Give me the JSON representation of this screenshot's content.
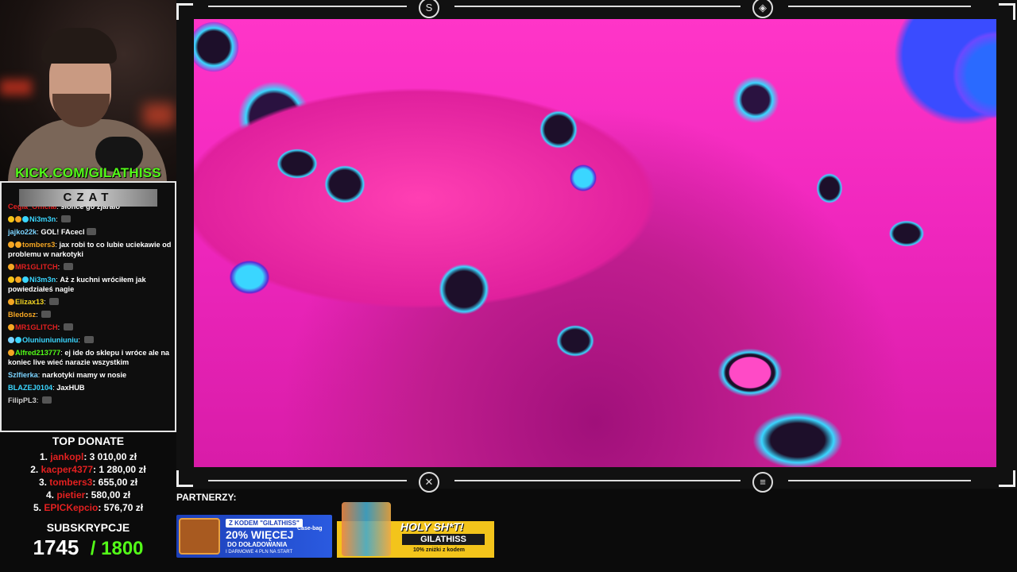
{
  "webcam": {
    "overlay_url": "KICK.COM/GILATHISS"
  },
  "chat": {
    "title": "CZAT",
    "messages": [
      {
        "user": "Cegla_Official",
        "user_color": "#e32020",
        "text": "słońce go zjarało",
        "badges": []
      },
      {
        "user": "Ni3m3n",
        "user_color": "#3ad6ff",
        "text": "",
        "badges": [
          "crown",
          "clock",
          "gem"
        ],
        "emote": true
      },
      {
        "user": "jajko22k",
        "user_color": "#7bd3ff",
        "text": "GOL! FAcecl",
        "badges": [],
        "emote": true
      },
      {
        "user": "tombers3",
        "user_color": "#f5a623",
        "text": "jax robi to co lubie uciekawie od problemu w narkotyki",
        "badges": [
          "clock",
          "clock"
        ]
      },
      {
        "user": "MR1GLITCH",
        "user_color": "#e32020",
        "text": "",
        "badges": [
          "clock"
        ],
        "emote": true
      },
      {
        "user": "Ni3m3n",
        "user_color": "#3ad6ff",
        "text": "Aż z kuchni wróciłem jak powiedziałeś nagie",
        "badges": [
          "crown",
          "clock",
          "gem"
        ]
      },
      {
        "user": "Elizax13",
        "user_color": "#f5d623",
        "text": "",
        "badges": [
          "clock"
        ],
        "emote": true
      },
      {
        "user": "Bledosz",
        "user_color": "#f5a623",
        "text": "",
        "badges": [],
        "emote": true
      },
      {
        "user": "MR1GLITCH",
        "user_color": "#e32020",
        "text": "",
        "badges": [
          "clock"
        ],
        "emote": true
      },
      {
        "user": "Oluniuniuniuniu",
        "user_color": "#3ad6ff",
        "text": "",
        "badges": [
          "sword",
          "gem"
        ],
        "emote": true
      },
      {
        "user": "Alfred213777",
        "user_color": "#53fc18",
        "text": "ej ide do sklepu i wróce ale na koniec live wieć narazie wszystkim",
        "badges": [
          "clock"
        ]
      },
      {
        "user": "Szlfierka",
        "user_color": "#7bd3ff",
        "text": "narkotyki mamy w nosie",
        "badges": []
      },
      {
        "user": "BLAZEJ0104",
        "user_color": "#3ad6ff",
        "text": "JaxHUB",
        "badges": []
      },
      {
        "user": "FilipPL3",
        "user_color": "#cfcfcf",
        "text": "",
        "badges": [],
        "emote": true
      }
    ]
  },
  "top_donate": {
    "title": "TOP DONATE",
    "entries": [
      {
        "rank": "1.",
        "name": "jankopl",
        "amount": "3 010,00 zł"
      },
      {
        "rank": "2.",
        "name": "kacper4377",
        "amount": "1 280,00 zł"
      },
      {
        "rank": "3.",
        "name": "tombers3",
        "amount": "655,00 zł"
      },
      {
        "rank": "4.",
        "name": "pietier",
        "amount": "580,00 zł"
      },
      {
        "rank": "5.",
        "name": "EPICKepcio",
        "amount": "576,70 zł"
      }
    ]
  },
  "subs": {
    "title": "SUBSKRYPCJE",
    "current": "1745",
    "goal": "/ 1800"
  },
  "partners": {
    "label": "PARTNERZY:",
    "banner1": {
      "code": "Z KODEM \"GILATHISS\"",
      "headline": "20% WIĘCEJ",
      "line2": "DO DOŁADOWANIA",
      "line3": "I DARMOWE 4 PLN NA START",
      "brand": "Case-bag"
    },
    "banner2": {
      "headline": "HOLY SH*T!",
      "code": "GILATHISS",
      "discount": "10% zniżki z kodem"
    }
  },
  "colors": {
    "kick_green": "#53fc18",
    "donor_red": "#e32020",
    "video_pink": "#f027be",
    "accent_cyan": "#3ad6ff"
  }
}
